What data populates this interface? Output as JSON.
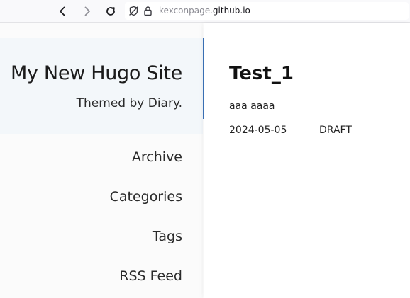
{
  "browser": {
    "url_prefix": "kexconpage.",
    "url_domain": "github.io"
  },
  "sidebar": {
    "title": "My New Hugo Site",
    "subtitle": "Themed by Diary.",
    "nav": [
      {
        "label": "Archive"
      },
      {
        "label": "Categories"
      },
      {
        "label": "Tags"
      },
      {
        "label": "RSS Feed"
      }
    ],
    "accent_color": "#3b73b9"
  },
  "post": {
    "title": "Test_1",
    "excerpt": "aaa aaaa",
    "date": "2024-05-05",
    "status": "DRAFT"
  }
}
